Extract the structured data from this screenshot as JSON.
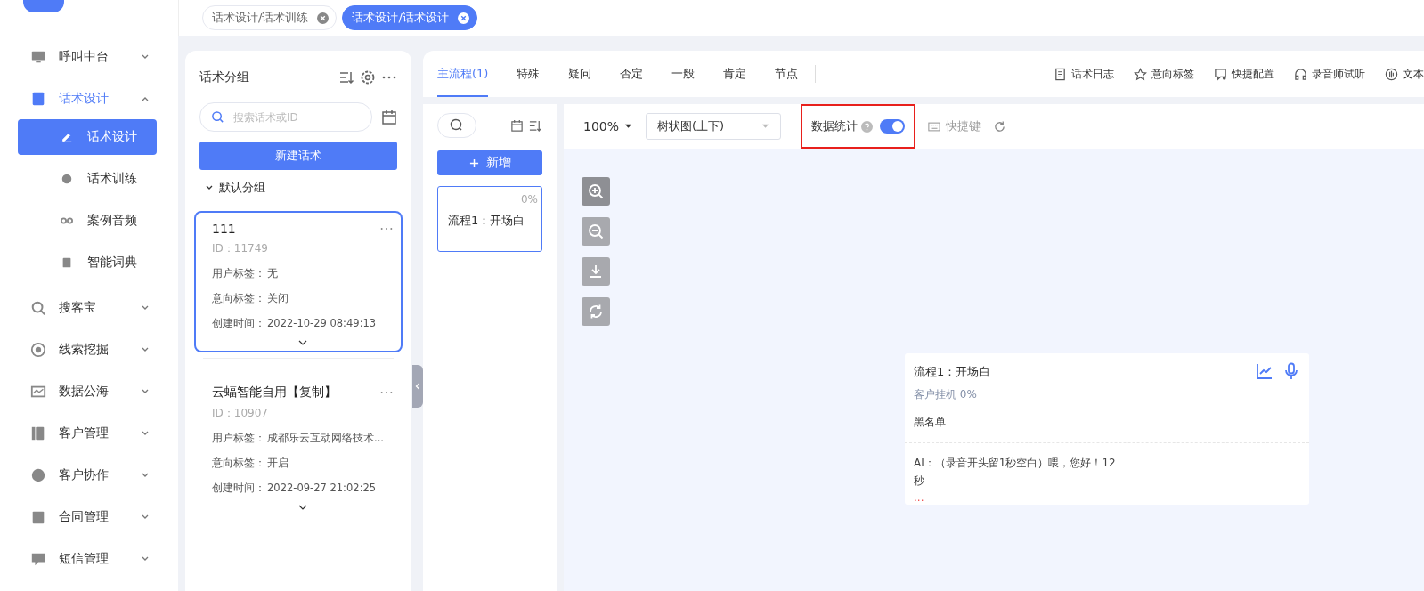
{
  "sidebar": {
    "items": [
      {
        "label": "呼叫中台",
        "expanded": false
      },
      {
        "label": "话术设计",
        "expanded": true,
        "children": [
          {
            "label": "话术设计",
            "selected": true
          },
          {
            "label": "话术训练",
            "selected": false
          },
          {
            "label": "案例音频",
            "selected": false
          },
          {
            "label": "智能词典",
            "selected": false
          }
        ]
      },
      {
        "label": "搜客宝",
        "expanded": false
      },
      {
        "label": "线索挖掘",
        "expanded": false
      },
      {
        "label": "数据公海",
        "expanded": false
      },
      {
        "label": "客户管理",
        "expanded": false
      },
      {
        "label": "客户协作",
        "expanded": false
      },
      {
        "label": "合同管理",
        "expanded": false
      },
      {
        "label": "短信管理",
        "expanded": false
      }
    ]
  },
  "page_tabs": [
    {
      "label": "话术设计/话术训练",
      "selected": false
    },
    {
      "label": "话术设计/话术设计",
      "selected": true
    }
  ],
  "group_panel": {
    "title": "话术分组",
    "search": {
      "placeholder": "搜索话术或ID"
    },
    "new_button": "新建话术",
    "group": {
      "label": "默认分组",
      "expanded": true
    },
    "cards": [
      {
        "title": "111",
        "id": "ID：11749",
        "selected": true,
        "fields": [
          {
            "label": "用户标签：",
            "value": "无"
          },
          {
            "label": "意向标签：",
            "value": "关闭"
          },
          {
            "label": "创建时间：",
            "value": "2022-10-29 08:49:13"
          }
        ]
      },
      {
        "title": "云蝠智能自用【复制】",
        "id": "ID：10907",
        "selected": false,
        "fields": [
          {
            "label": "用户标签：",
            "value": "成都乐云互动网络技术..."
          },
          {
            "label": "意向标签：",
            "value": "开启"
          },
          {
            "label": "创建时间：",
            "value": "2022-09-27 21:02:25"
          }
        ]
      }
    ]
  },
  "flow_tabs": [
    {
      "label": "主流程(1)",
      "selected": true
    },
    {
      "label": "特殊",
      "selected": false
    },
    {
      "label": "疑问",
      "selected": false
    },
    {
      "label": "否定",
      "selected": false
    },
    {
      "label": "一般",
      "selected": false
    },
    {
      "label": "肯定",
      "selected": false
    },
    {
      "label": "节点",
      "selected": false
    }
  ],
  "actions": [
    {
      "label": "话术日志"
    },
    {
      "label": "意向标签"
    },
    {
      "label": "快捷配置"
    },
    {
      "label": "录音师试听"
    },
    {
      "label": "文本"
    }
  ],
  "toolbar": {
    "zoom": "100%",
    "layout": "树状图(上下)",
    "stats": {
      "label": "数据统计",
      "on": true,
      "highlighted": true
    },
    "shortcut": "快捷键"
  },
  "flow_list": {
    "add_button": "新增",
    "flows": [
      {
        "percent": "0%",
        "name": "流程1：开场白",
        "selected": true
      }
    ]
  },
  "node": {
    "title": "流程1：开场白",
    "stat": "客户挂机 0%",
    "tag": "黑名单",
    "text": "AI：（录音开头留1秒空白）喂，您好！12秒",
    "more": "..."
  }
}
